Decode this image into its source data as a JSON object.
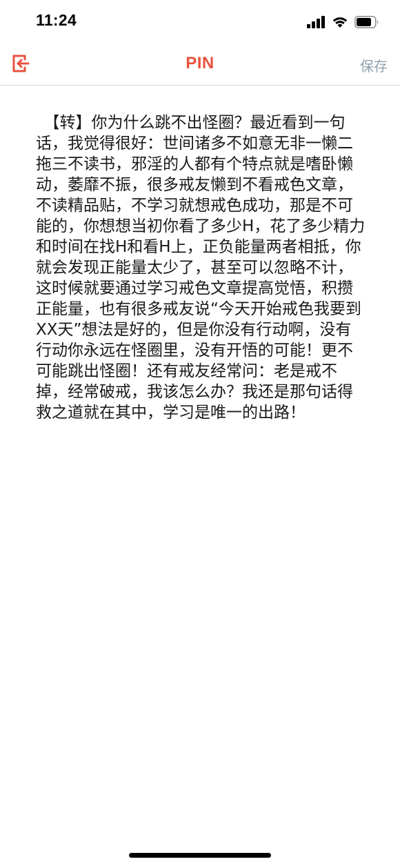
{
  "status_bar": {
    "time": "11:24",
    "icons": [
      "cellular-signal-icon",
      "wifi-icon",
      "battery-icon"
    ]
  },
  "nav": {
    "back_icon": "exit-arrow-icon",
    "title": "PIN",
    "save_label": "保存",
    "accent_color": "#e8533f",
    "save_color": "#8fa0ab"
  },
  "article": {
    "text": "　【转】你为什么跳不出怪圈？最近看到一句话，我觉得很好：世间诸多不如意无非一懒二拖三不读书，邪淫的人都有个特点就是嗜卧懒动，萎靡不振，很多戒友懒到不看戒色文章，不读精品贴，不学习就想戒色成功，那是不可能的，你想想当初你看了多少H，花了多少精力和时间在找H和看H上，正负能量两者相抵，你就会发现正能量太少了，甚至可以忽略不计，这时候就要通过学习戒色文章提高觉悟，积攒正能量，也有很多戒友说“今天开始戒色我要到XX天”想法是好的，但是你没有行动啊，没有行动你永远在怪圈里，没有开悟的可能！更不可能跳出怪圈！还有戒友经常问：老是戒不掉，经常破戒，我该怎么办？我还是那句话得救之道就在其中，学习是唯一的出路！"
  }
}
